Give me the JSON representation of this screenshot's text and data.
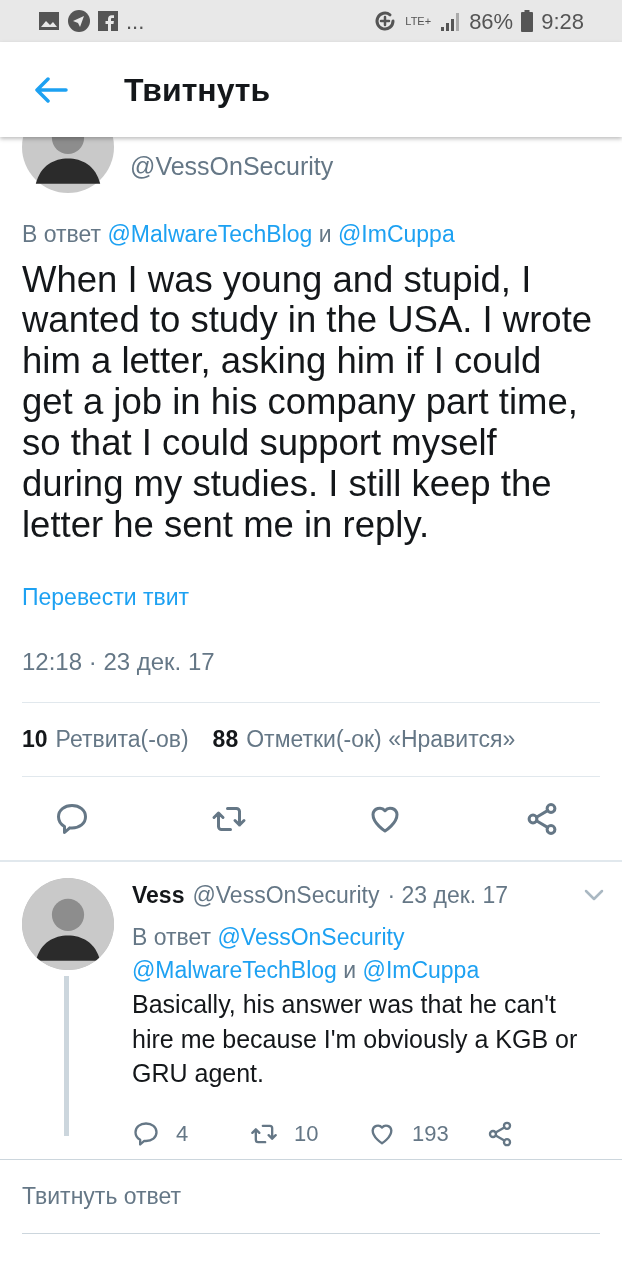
{
  "status_bar": {
    "more": "...",
    "network": "LTE+",
    "battery": "86%",
    "time": "9:28"
  },
  "header": {
    "title": "Твитнуть"
  },
  "tweet": {
    "handle": "@VessOnSecurity",
    "reply_to": [
      {
        "kind": "text",
        "text": "В ответ"
      },
      {
        "kind": "mention",
        "text": "@MalwareTechBlog"
      },
      {
        "kind": "text",
        "text": "и"
      },
      {
        "kind": "mention",
        "text": "@ImCuppa"
      }
    ],
    "text": "When I was young and stupid, I wanted to study in the USA. I wrote him a letter, asking him if I could get a job in his company part time, so that I could support myself during my studies. I still keep the letter he sent me in reply.",
    "translate": "Перевести твит",
    "timestamp": "12:18 · 23 дек. 17",
    "stats": [
      {
        "count": "10",
        "label": "Ретвита(-ов)"
      },
      {
        "count": "88",
        "label": "Отметки(-ок) «Нравится»"
      }
    ]
  },
  "reply": {
    "name": "Vess",
    "handle": "@VessOnSecurity",
    "date": "· 23 дек. 17",
    "reply_to": [
      {
        "kind": "text",
        "text": "В ответ"
      },
      {
        "kind": "mention",
        "text": "@VessOnSecurity"
      },
      {
        "kind": "break"
      },
      {
        "kind": "mention",
        "text": "@MalwareTechBlog"
      },
      {
        "kind": "text",
        "text": "и"
      },
      {
        "kind": "mention",
        "text": "@ImCuppa"
      }
    ],
    "text": "Basically, his answer was that he can't hire me because I'm obviously a KGB or GRU agent.",
    "actions": [
      {
        "kind": "reply",
        "count": "4"
      },
      {
        "kind": "retweet",
        "count": "10"
      },
      {
        "kind": "like",
        "count": "193"
      },
      {
        "kind": "share"
      }
    ]
  },
  "compose": {
    "placeholder": "Твитнуть ответ"
  }
}
